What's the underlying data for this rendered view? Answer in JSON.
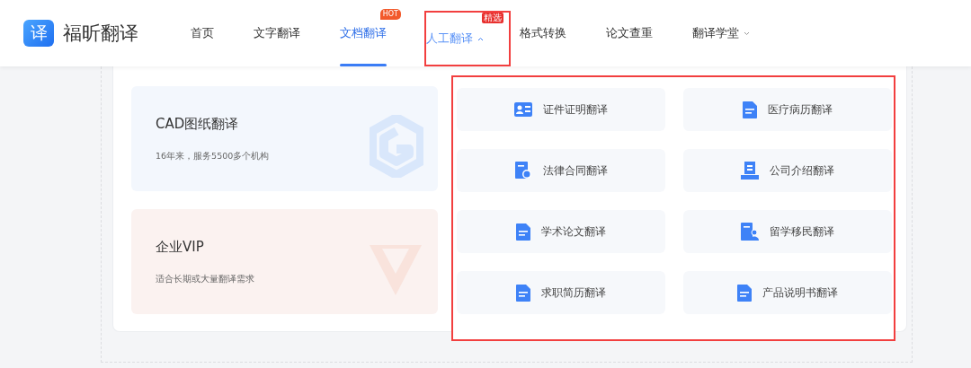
{
  "header": {
    "logo_glyph": "译",
    "brand": "福昕翻译",
    "nav": [
      {
        "label": "首页",
        "selected": false,
        "open": false,
        "highlighted": false
      },
      {
        "label": "文字翻译",
        "selected": false,
        "open": false,
        "highlighted": false
      },
      {
        "label": "文档翻译",
        "selected": true,
        "open": false,
        "highlighted": false,
        "badge": "HOT"
      },
      {
        "label": "人工翻译",
        "selected": false,
        "open": true,
        "highlighted": true,
        "badge": "精选",
        "dropdown": true
      },
      {
        "label": "格式转换",
        "selected": false,
        "open": false,
        "highlighted": false
      },
      {
        "label": "论文查重",
        "selected": false,
        "open": false,
        "highlighted": false
      },
      {
        "label": "翻译学堂",
        "selected": false,
        "open": false,
        "highlighted": false,
        "dropdown": true
      }
    ]
  },
  "cards": [
    {
      "title": "CAD图纸翻译",
      "subtitle": "16年来，服务5500多个机构",
      "color": "#f3f7fd",
      "kind": "hexagon"
    },
    {
      "title": "企业VIP",
      "subtitle": "适合长期或大量翻译需求",
      "color": "#fbf2f0",
      "kind": "v"
    }
  ],
  "dropdown": {
    "highlighted": true,
    "items": [
      {
        "label": "证件证明翻译",
        "kind": "id-card"
      },
      {
        "label": "医疗病历翻译",
        "kind": "document"
      },
      {
        "label": "法律合同翻译",
        "kind": "document-seal"
      },
      {
        "label": "公司介绍翻译",
        "kind": "building"
      },
      {
        "label": "学术论文翻译",
        "kind": "document"
      },
      {
        "label": "留学移民翻译",
        "kind": "document-person"
      },
      {
        "label": "求职简历翻译",
        "kind": "document"
      },
      {
        "label": "产品说明书翻译",
        "kind": "document"
      }
    ]
  }
}
